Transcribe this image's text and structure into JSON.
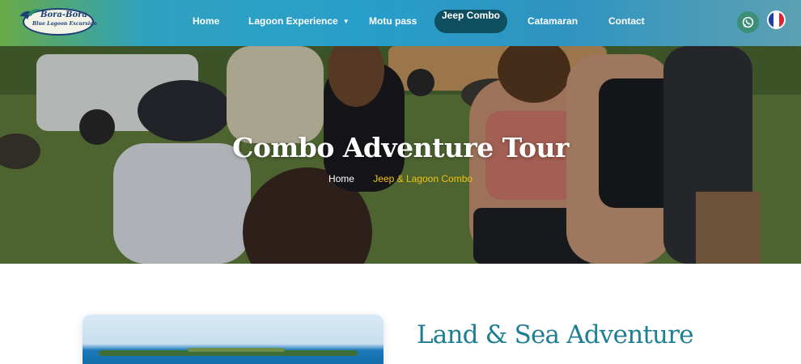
{
  "header": {
    "logo": {
      "line1": "Bora-Bora",
      "line2": "Blue Lagoon Excursion"
    },
    "nav": [
      {
        "label": "Home"
      },
      {
        "label": "Lagoon Experience"
      },
      {
        "label": "Motu pass"
      },
      {
        "label": "Jeep Combo"
      },
      {
        "label": "Catamaran"
      },
      {
        "label": "Contact"
      }
    ],
    "active_item": "Jeep Combo",
    "whatsapp_icon": "whatsapp-icon",
    "language_flag": "french-flag-icon"
  },
  "hero": {
    "title": "Combo Adventure Tour",
    "breadcrumb": {
      "home": "Home",
      "current": "Jeep & Lagoon Combo"
    }
  },
  "content": {
    "section_title": "Land & Sea Adventure"
  },
  "colors": {
    "accent_teal": "#1e7f93",
    "active_nav_bg": "#0f4f5f",
    "breadcrumb_current": "#f1c40f"
  }
}
